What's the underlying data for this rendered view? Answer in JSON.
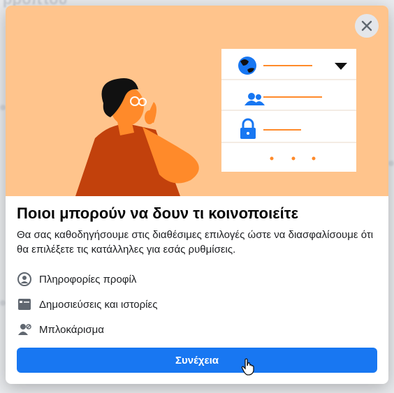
{
  "background": {
    "page_title_fragment": "ρροπτου"
  },
  "dialog": {
    "close_label": "Κλείσιμο",
    "title": "Ποιοι μπορούν να δουν τι κοινοποιείτε",
    "description": "Θα σας καθοδηγήσουμε στις διαθέσιμες επιλογές ώστε να διασφαλίσουμε ότι θα επιλέξετε τις κατάλληλες για εσάς ρυθμίσεις.",
    "features": [
      {
        "icon": "profile-icon",
        "label": "Πληροφορίες προφίλ"
      },
      {
        "icon": "posts-stories-icon",
        "label": "Δημοσιεύσεις και ιστορίες"
      },
      {
        "icon": "blocking-icon",
        "label": "Μπλοκάρισμα"
      }
    ],
    "continue_label": "Συνέχεια"
  },
  "colors": {
    "accent": "#1877f2",
    "hero_bg": "#ffc48c",
    "illustration_orange": "#ff8a2a",
    "illustration_dark_orange": "#c2410c"
  }
}
